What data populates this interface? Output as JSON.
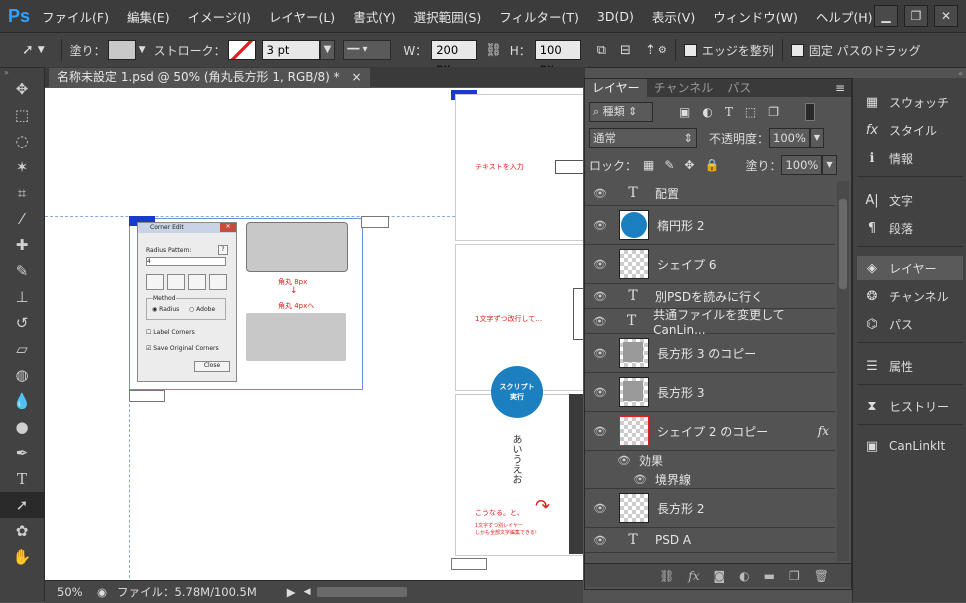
{
  "app": {
    "logo": "Ps"
  },
  "menu": [
    "ファイル(F)",
    "編集(E)",
    "イメージ(I)",
    "レイヤー(L)",
    "書式(Y)",
    "選択範囲(S)",
    "フィルター(T)",
    "3D(D)",
    "表示(V)",
    "ウィンドウ(W)",
    "ヘルプ(H)"
  ],
  "window_controls": {
    "minimize": "▁",
    "restore": "❐",
    "close": "✕"
  },
  "options": {
    "fill_label": "塗り：",
    "stroke_label": "ストローク：",
    "stroke_size": "3 pt",
    "w_label": "W：",
    "w_value": "200 px",
    "h_label": "H：",
    "h_value": "100 px",
    "edge_align_label": "エッジを整列",
    "fixed_path_label": "固定 パスのドラッグ"
  },
  "document": {
    "tab_title": "名称未設定 1.psd @ 50% (角丸長方形 1, RGB/8) *",
    "tab_close": "×",
    "zoom": "50%",
    "file_info": "ファイル：5.78M/100.5M"
  },
  "canvas_content": {
    "corner_edit_title": "Corner Edit",
    "radius_pattern_label": "Radius Pattern:",
    "radius_value": "4",
    "method_label": "Method",
    "radius_option": "Radius",
    "adobe_option": "Adobe",
    "label_corners": "Label Corners",
    "save_corners": "Save Original Corners",
    "close_button": "Close",
    "radius_8": "角丸 8px",
    "radius_4": "角丸 4pxへ",
    "text_input_note": "テキストを入力",
    "line_break_note": "1文字ずつ改行して…",
    "script_run": "スクリプト\n実行",
    "vertical_text": "あいうえお",
    "result_note": "こうなる。と、",
    "result_sub": "1文字ずつ別レイヤー\nしかも全部文字編集できる!"
  },
  "layers_panel": {
    "tabs": [
      "レイヤー",
      "チャンネル",
      "パス"
    ],
    "filter_kind": "種類",
    "blend_mode": "通常",
    "opacity_label": "不透明度：",
    "opacity_value": "100%",
    "lock_label": "ロック：",
    "fill_label": "塗り：",
    "fill_value": "100%",
    "layers": [
      {
        "name": "配置",
        "kind": "text"
      },
      {
        "name": "楕円形 2",
        "kind": "ellipse"
      },
      {
        "name": "シェイプ 6",
        "kind": "shape"
      },
      {
        "name": "別PSDを読みに行く",
        "kind": "text"
      },
      {
        "name": "共通ファイルを変更して CanLin...",
        "kind": "text"
      },
      {
        "name": "長方形 3 のコピー",
        "kind": "rect"
      },
      {
        "name": "長方形 3",
        "kind": "rect"
      },
      {
        "name": "シェイプ 2 のコピー",
        "kind": "shape",
        "fx": "fx"
      },
      {
        "name": "効果",
        "kind": "effects"
      },
      {
        "name": "境界線",
        "kind": "effect"
      },
      {
        "name": "長方形 2",
        "kind": "rect"
      },
      {
        "name": "PSD A",
        "kind": "text"
      }
    ]
  },
  "dock": {
    "items": [
      "スウォッチ",
      "スタイル",
      "情報",
      "文字",
      "段落",
      "レイヤー",
      "チャンネル",
      "パス",
      "属性",
      "ヒストリー",
      "CanLinkIt"
    ]
  },
  "colors": {
    "accent": "#1c7fc0",
    "menu_bg": "#3c3c3c",
    "panel_bg": "#535353",
    "red_note": "#e0201c"
  }
}
